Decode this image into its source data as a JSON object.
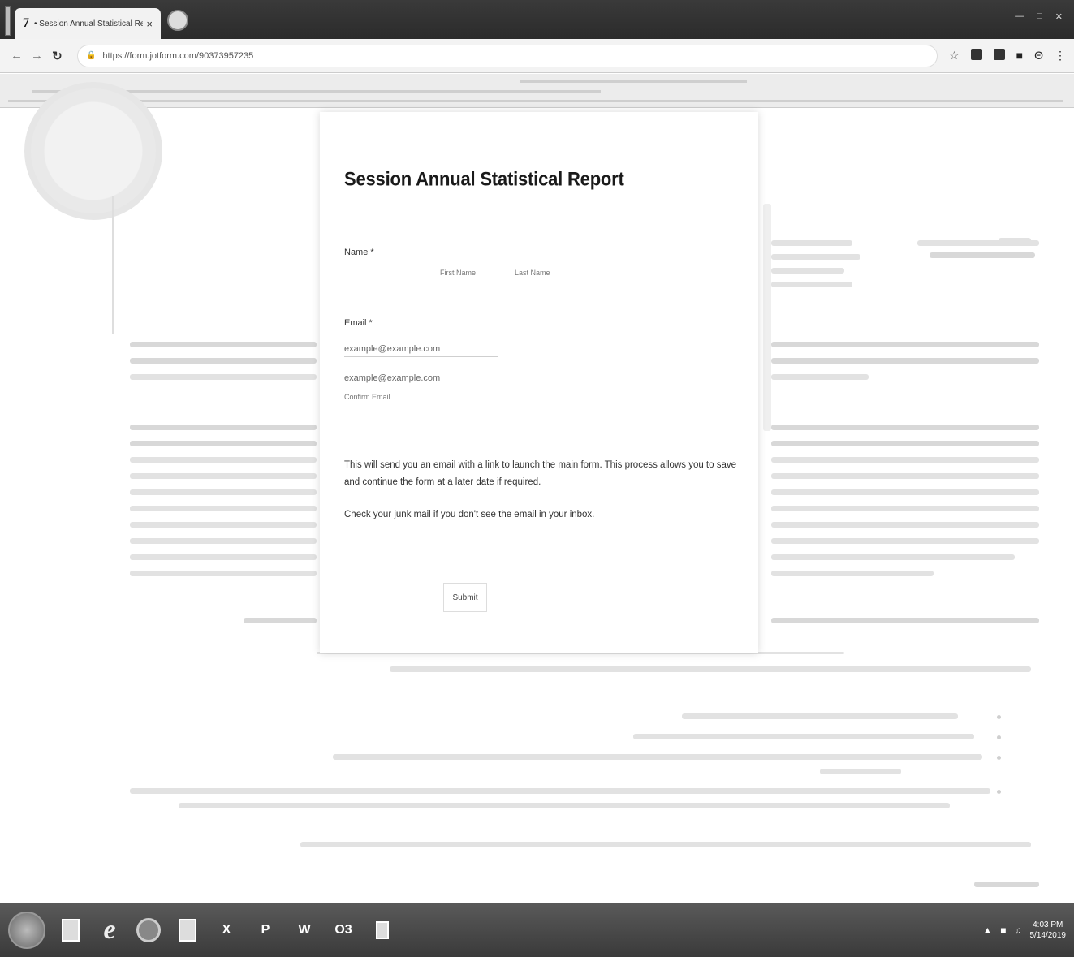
{
  "browser": {
    "tab_favicon": "7",
    "tab_title": "• Session Annual Statistical Rep",
    "tab_close": "×",
    "url": "https://form.jotform.com/90373957235",
    "icons": [
      "back-icon",
      "forward-icon",
      "reload-icon",
      "lock-icon",
      "star-icon",
      "extension-icon",
      "menu-icon"
    ]
  },
  "form": {
    "title": "Session Annual Statistical Report",
    "name_label": "Name",
    "required_mark": "*",
    "first_name_sublabel": "First Name",
    "last_name_sublabel": "Last Name",
    "email_label": "Email",
    "email_placeholder": "example@example.com",
    "confirm_email_placeholder": "example@example.com",
    "confirm_email_sublabel": "Confirm Email",
    "info_text": "This will send you an email with a link to launch the main form. This process allows you to save and continue the form at a later date if required.",
    "junk_text": "Check your junk mail if you don't see the email in your inbox.",
    "submit_label": "Submit"
  },
  "taskbar": {
    "apps": [
      "start-orb",
      "file-explorer",
      "internet-explorer",
      "chrome",
      "app-box",
      "excel",
      "powerpoint",
      "word",
      "outlook",
      "app-extra"
    ],
    "app_ie": "e",
    "app_box_label": "",
    "app_x": "X",
    "app_p": "P",
    "app_w": "W",
    "app_o": "O3",
    "time": "4:03 PM",
    "date": "5/14/2019"
  },
  "colors": {
    "title_bar": "#2f2f2f",
    "toolbar": "#f3f3f3",
    "taskbar": "#4a4a4a",
    "modal_bg": "#ffffff"
  }
}
